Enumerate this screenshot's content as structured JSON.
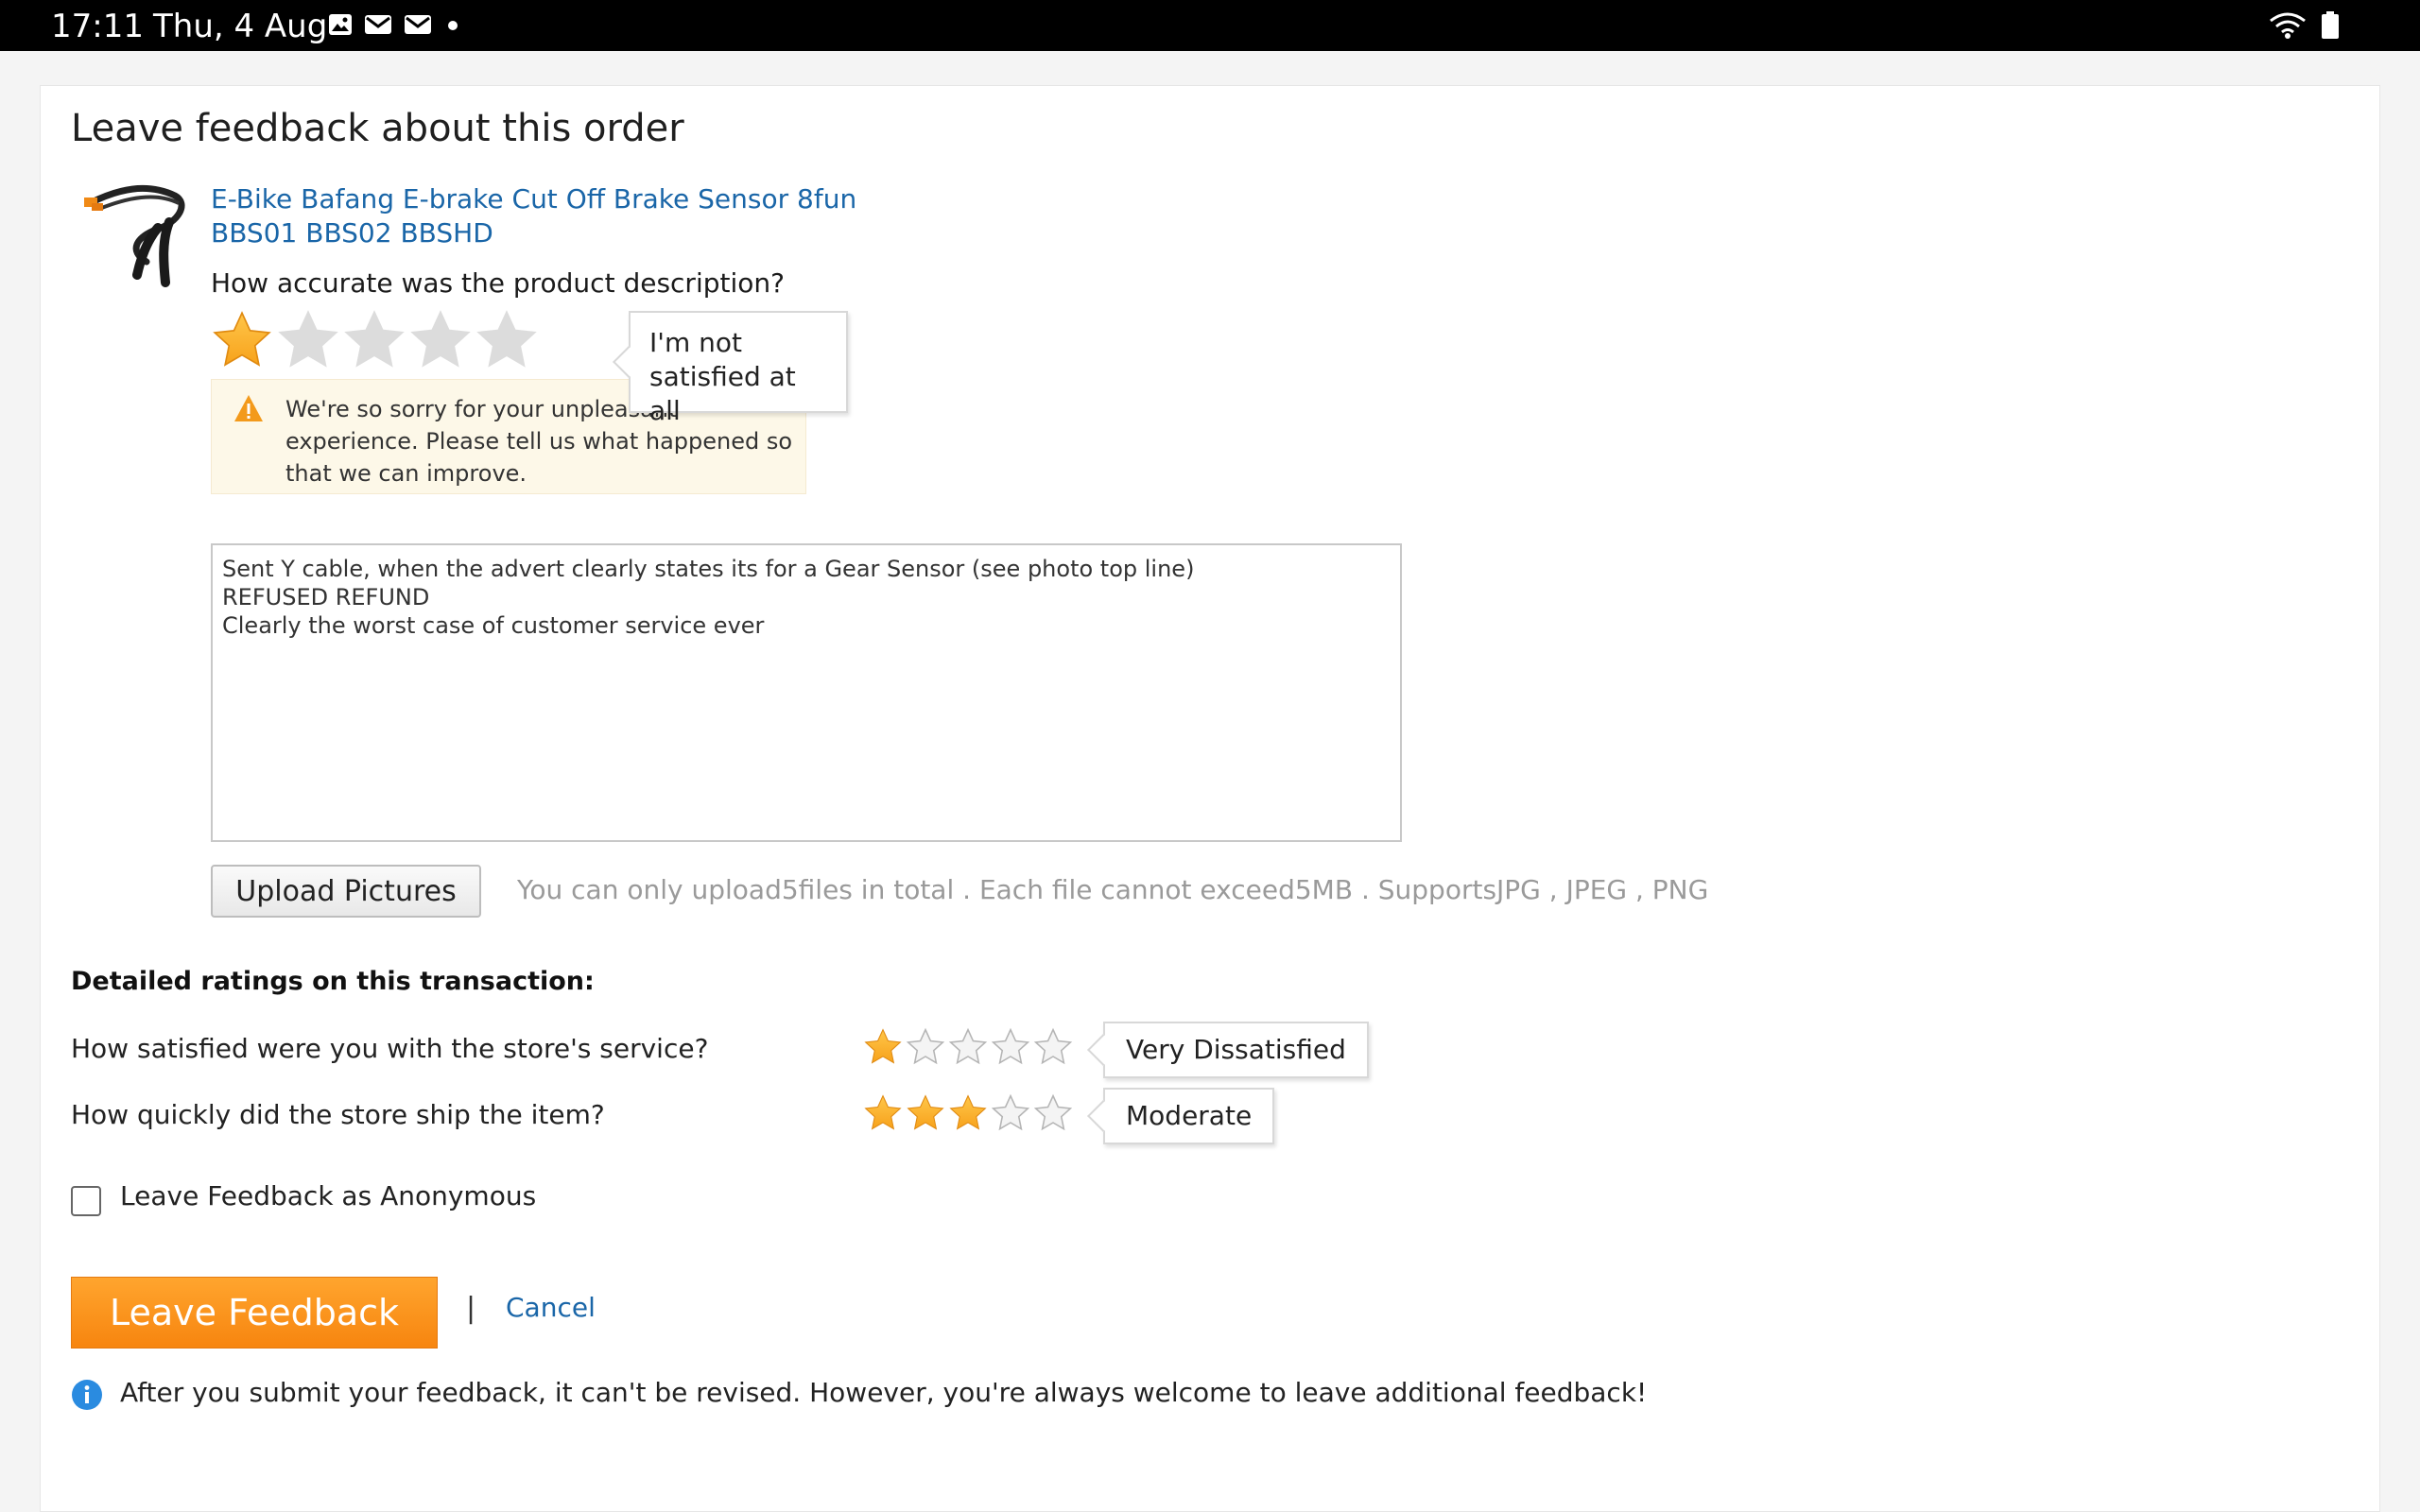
{
  "status_bar": {
    "time": "17:11",
    "date": "Thu, 4 Aug",
    "icons": [
      "gallery-icon",
      "mail-icon",
      "mail-icon",
      "dot-icon"
    ],
    "right_icons": [
      "wifi-icon",
      "battery-icon"
    ]
  },
  "page": {
    "title": "Leave feedback about this order"
  },
  "product": {
    "image": "brake-sensor-cable-image",
    "name": "E-Bike Bafang E-brake Cut Off Brake Sensor 8fun BBS01 BBS02 BBSHD"
  },
  "accuracy": {
    "question": "How accurate was the product description?",
    "rating": 1,
    "max": 5,
    "tooltip": "I'm not satisfied at all",
    "warning": "We're so sorry for your unpleasant experience. Please tell us what happened so that we can improve."
  },
  "feedback_text": "Sent Y cable, when the advert clearly states its for a Gear Sensor (see photo top line)\nREFUSED REFUND\nClearly the worst case of customer service ever",
  "upload": {
    "button_label": "Upload Pictures",
    "hint": "You can only upload5files in total . Each file cannot exceed5MB . SupportsJPG , JPEG , PNG"
  },
  "detailed": {
    "title": "Detailed ratings on this transaction:",
    "service": {
      "question": "How satisfied were you with the store's service?",
      "rating": 1,
      "max": 5,
      "tooltip": "Very Dissatisfied"
    },
    "shipping": {
      "question": "How quickly did the store ship the item?",
      "rating": 3,
      "max": 5,
      "tooltip": "Moderate"
    }
  },
  "anonymous": {
    "label": "Leave Feedback as Anonymous",
    "checked": false
  },
  "actions": {
    "submit_label": "Leave Feedback",
    "divider": "|",
    "cancel_label": "Cancel"
  },
  "notice": "After you submit your feedback, it can't be revised. However, you're always welcome to leave additional feedback!",
  "colors": {
    "link": "#1a66a8",
    "star_on": "#f7a21b",
    "star_off": "#d5d5d5",
    "primary_button": "#f7850f"
  }
}
